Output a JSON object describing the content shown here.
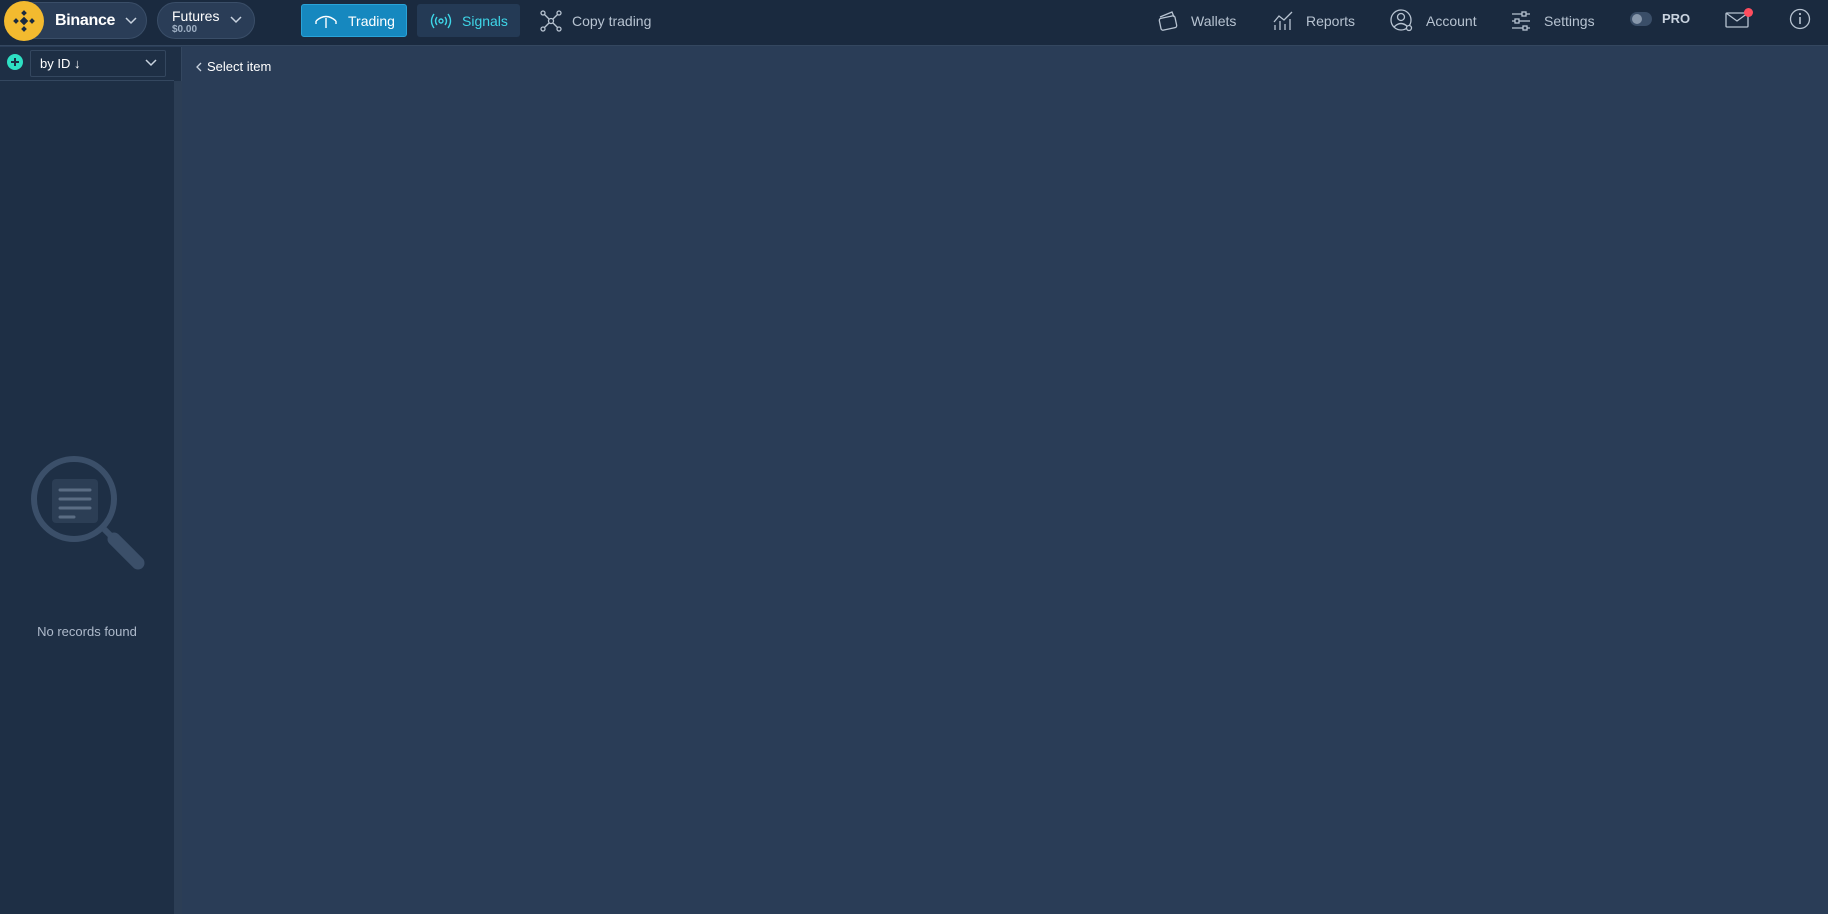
{
  "header": {
    "exchange": {
      "name": "Binance",
      "logo_color": "#f3ba2f"
    },
    "market": {
      "name": "Futures",
      "balance": "$0.00"
    },
    "nav": [
      {
        "label": "Trading",
        "icon": "trading-icon",
        "active": true
      },
      {
        "label": "Signals",
        "icon": "signals-icon"
      },
      {
        "label": "Copy trading",
        "icon": "copy-trading-icon"
      }
    ],
    "right_nav": [
      {
        "label": "Wallets",
        "icon": "wallet-icon"
      },
      {
        "label": "Reports",
        "icon": "reports-icon"
      },
      {
        "label": "Account",
        "icon": "account-icon"
      },
      {
        "label": "Settings",
        "icon": "settings-icon"
      }
    ],
    "pro_label": "PRO",
    "pro_enabled": false,
    "has_unread_messages": true
  },
  "sidebar": {
    "sort": {
      "value": "by ID ↓"
    },
    "empty_text": "No records found"
  },
  "main": {
    "back_label": "Select item"
  },
  "colors": {
    "accent": "#1688bf",
    "signals": "#3ed6e8",
    "add": "#2ee0c4",
    "notification": "#ff4d5e"
  }
}
